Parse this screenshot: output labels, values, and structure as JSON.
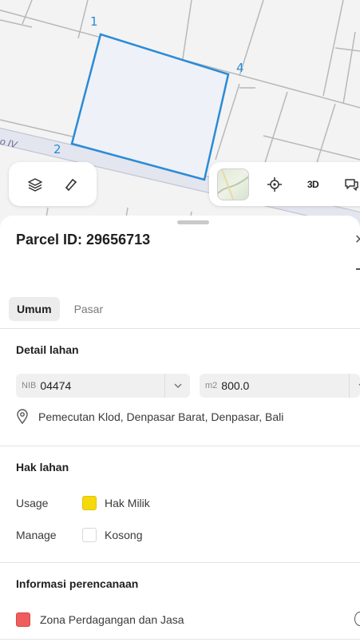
{
  "map": {
    "road_label": "o IV",
    "parcel_vertices": [
      "1",
      "2",
      "4"
    ],
    "parcel_color": "#2a8bd6",
    "tools_left": [
      "layers-icon",
      "measure-icon"
    ],
    "tools_right": [
      "basemap-thumbnail",
      "locate-icon",
      "3d-toggle",
      "feedback-icon"
    ],
    "btn_3d": "3D"
  },
  "sheet": {
    "title": "Parcel ID: 29656713",
    "close": "✕",
    "tabs": [
      {
        "label": "Umum",
        "active": true
      },
      {
        "label": "Pasar",
        "active": false
      }
    ],
    "detail": {
      "title": "Detail lahan",
      "nib_prefix": "NIB",
      "nib_value": "04474",
      "area_prefix": "m2",
      "area_value": "800.0",
      "address": "Pemecutan Klod, Denpasar Barat, Denpasar, Bali"
    },
    "hak": {
      "title": "Hak lahan",
      "rows": [
        {
          "label": "Usage",
          "value": "Hak Milik",
          "color": "#f5d90a"
        },
        {
          "label": "Manage",
          "value": "Kosong",
          "color": "#ffffff"
        }
      ]
    },
    "perencanaan": {
      "title": "Informasi perencanaan",
      "zona": "Zona Perdagangan dan Jasa",
      "zona_color": "#ef5d5d"
    }
  }
}
